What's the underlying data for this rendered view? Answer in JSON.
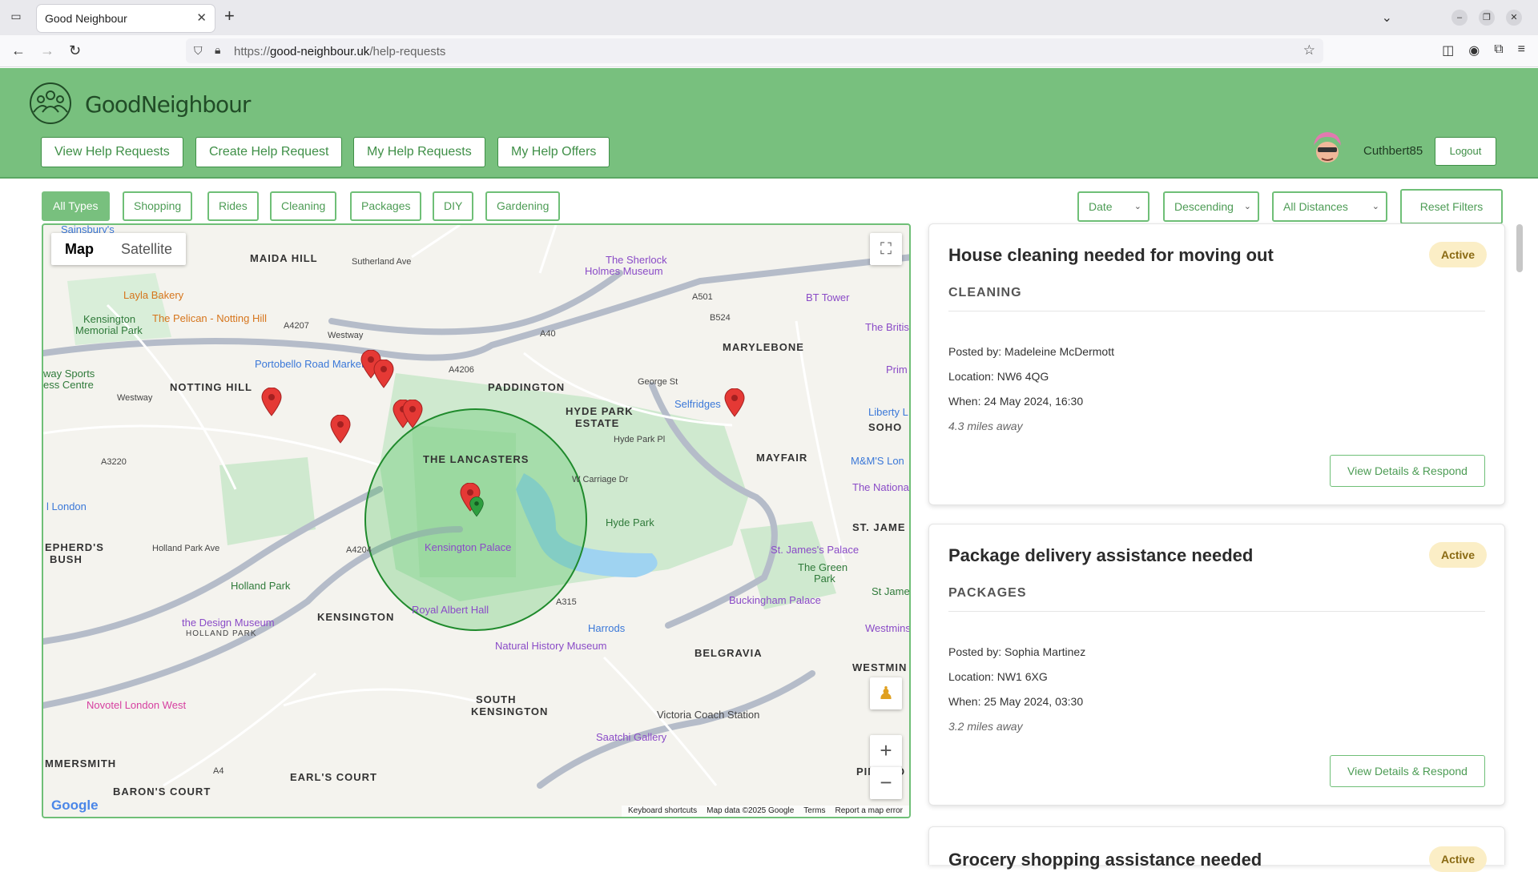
{
  "browser": {
    "tab_title": "Good Neighbour",
    "url_prefix": "https://",
    "url_host": "good-neighbour.uk",
    "url_path": "/help-requests"
  },
  "site": {
    "logo_text": "GoodNeighbour",
    "nav": {
      "view": "View Help Requests",
      "create": "Create Help Request",
      "mine": "My Help Requests",
      "offers": "My Help Offers"
    },
    "username": "Cuthbert85",
    "logout": "Logout"
  },
  "filters": {
    "types": [
      "All Types",
      "Shopping",
      "Rides",
      "Cleaning",
      "Packages",
      "DIY",
      "Gardening"
    ],
    "active_type": "All Types",
    "sort_by": "Date",
    "order": "Descending",
    "distance": "All Distances",
    "reset": "Reset Filters"
  },
  "map": {
    "type_map": "Map",
    "type_satellite": "Satellite",
    "logo": "Google",
    "footer": {
      "shortcuts": "Keyboard shortcuts",
      "data": "Map data ©2025 Google",
      "terms": "Terms",
      "report": "Report a map error"
    },
    "areas": {
      "maida_hill": "MAIDA HILL",
      "notting_hill": "NOTTING HILL",
      "paddington": "PADDINGTON",
      "hyde_park_estate": "HYDE PARK",
      "hyde_park_estate2": "ESTATE",
      "marylebone": "MARYLEBONE",
      "lancasters": "THE LANCASTERS",
      "mayfair": "MAYFAIR",
      "soho": "SOHO",
      "shepherds1": "EPHERD'S",
      "shepherds2": "BUSH",
      "kensington": "KENSINGTON",
      "holland_park_area": "HOLLAND PARK",
      "belgravia": "BELGRAVIA",
      "south_ken1": "SOUTH",
      "south_ken2": "KENSINGTON",
      "hammersmith": "MMERSMITH",
      "barons_court": "BARON'S COURT",
      "earls_court": "EARL'S COURT",
      "pimlico": "PIMLICO",
      "westminster": "WESTMIN",
      "st_james": "ST. JAME"
    },
    "places": {
      "sainsburys": "Sainsbury's",
      "layla": "Layla Bakery",
      "kensington_memorial": "Kensington",
      "kensington_memorial2": "Memorial Park",
      "pelican": "The Pelican - Notting Hill",
      "portobello": "Portobello Road Market",
      "sports": "way Sports",
      "sports2": "ess Centre",
      "sherlock": "The Sherlock",
      "sherlock2": "Holmes Museum",
      "bt_tower": "BT Tower",
      "selfridges": "Selfridges",
      "liberty": "Liberty L",
      "mms": "M&M'S Lon",
      "national": "The Nationa",
      "britis": "The Britis",
      "prim": "Prim",
      "london": "l London",
      "kensington_palace": "Kensington Palace",
      "hyde_park": "Hyde Park",
      "holland_park": "Holland Park",
      "st_james_palace": "St. James's Palace",
      "green_park": "The Green",
      "green_park2": "Park",
      "st_james_park": "St Jame",
      "buckingham": "Buckingham Palace",
      "design_museum": "the Design Museum",
      "royal_albert": "Royal Albert Hall",
      "harrods": "Harrods",
      "nhm": "Natural History Museum",
      "novotel": "Novotel London West",
      "victoria": "Victoria Coach Station",
      "saatchi": "Saatchi Gallery",
      "westminster_abbey": "Westmins"
    },
    "roads": {
      "westway": "Westway",
      "westway2": "Westway",
      "a40": "A40",
      "a4206": "A4206",
      "a4207": "A4207",
      "a3220": "A3220",
      "holland_park_ave": "Holland Park Ave",
      "a4204": "A4204",
      "a315": "A315",
      "a4": "A4",
      "sutherland": "Sutherland Ave",
      "george_st": "George St",
      "hyde_park_pl": "Hyde Park Pl",
      "w_carriage": "W Carriage Dr",
      "b524": "B524",
      "a501": "A501"
    }
  },
  "requests": [
    {
      "title": "House cleaning needed for moving out",
      "status": "Active",
      "category": "CLEANING",
      "posted_by": "Posted by: Madeleine McDermott",
      "location": "Location: NW6 4QG",
      "when": "When: 24 May 2024, 16:30",
      "distance": "4.3 miles away",
      "action": "View Details & Respond"
    },
    {
      "title": "Package delivery assistance needed",
      "status": "Active",
      "category": "PACKAGES",
      "posted_by": "Posted by: Sophia Martinez",
      "location": "Location: NW1 6XG",
      "when": "When: 25 May 2024, 03:30",
      "distance": "3.2 miles away",
      "action": "View Details & Respond"
    },
    {
      "title": "Grocery shopping assistance needed",
      "status": "Active"
    }
  ],
  "colors": {
    "brand_green": "#78c07e",
    "badge_bg": "#fbeec6",
    "pin_red": "#e53935",
    "pin_user": "#2e9e3f"
  }
}
